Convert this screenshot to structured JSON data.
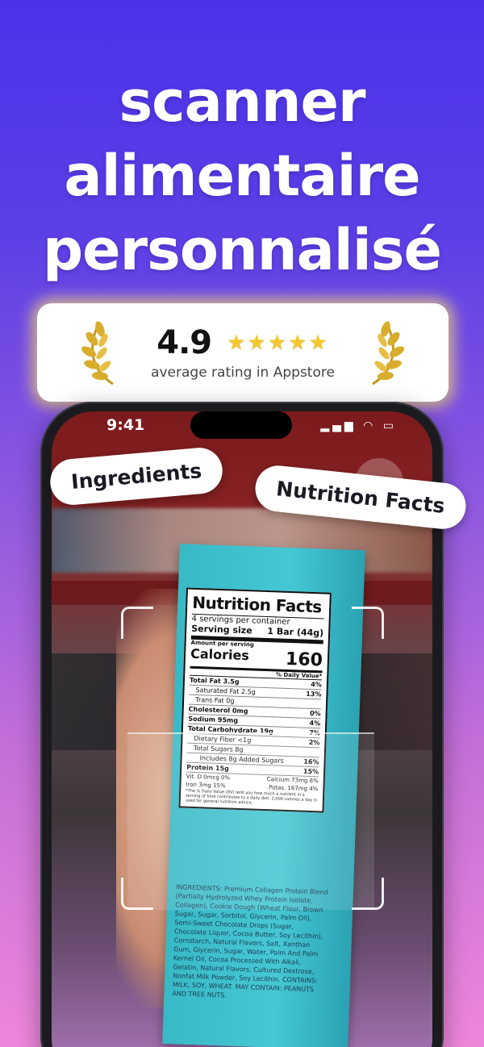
{
  "headline": {
    "line1": "scanner",
    "line2": "alimentaire",
    "line3": "personnalisé"
  },
  "rating": {
    "value": "4.9",
    "stars": "★★★★★",
    "caption": "average rating in Appstore"
  },
  "status_bar": {
    "time": "9:41",
    "icons": "▂▄▆ ◠ ▭"
  },
  "tags": {
    "ingredients": "Ingredients",
    "nutrition_facts": "Nutrition Facts"
  },
  "nutrition_label": {
    "title": "Nutrition Facts",
    "servings": "4 servings per container",
    "serving_size_label": "Serving size",
    "serving_size_value": "1 Bar (44g)",
    "amount_per_serving": "Amount per serving",
    "calories_label": "Calories",
    "calories_value": "160",
    "daily_value_header": "% Daily Value*",
    "rows": [
      {
        "label": "Total Fat 3.5g",
        "pct": "4%",
        "style": "bold"
      },
      {
        "label": "Saturated Fat 2.5g",
        "pct": "13%",
        "style": "indent"
      },
      {
        "label": "Trans Fat 0g",
        "pct": "",
        "style": "indent"
      },
      {
        "label": "Cholesterol 0mg",
        "pct": "0%",
        "style": "bold"
      },
      {
        "label": "Sodium 95mg",
        "pct": "4%",
        "style": "bold"
      },
      {
        "label": "Total Carbohydrate 19g",
        "pct": "7%",
        "style": "bold"
      },
      {
        "label": "Dietary Fiber <1g",
        "pct": "2%",
        "style": "indent"
      },
      {
        "label": "Total Sugars 8g",
        "pct": "",
        "style": "indent"
      },
      {
        "label": "Includes 8g Added Sugars",
        "pct": "16%",
        "style": "indent2"
      },
      {
        "label": "Protein 15g",
        "pct": "15%",
        "style": "bold"
      }
    ],
    "vitamins": [
      {
        "left": "Vit. D 0mcg 0%",
        "right": "Calcium 73mg 6%"
      },
      {
        "left": "Iron 3mg 15%",
        "right": "Potas. 167mg 4%"
      }
    ],
    "footnote": "*The % Daily Value (DV) tells you how much a nutrient in a serving of food contributes to a daily diet. 2,000 calories a day is used for general nutrition advice."
  },
  "ingredients_text": "INGREDIENTS: Premium Collagen Protein Blend (Partially Hydrolyzed Whey Protein Isolate, Collagen), Cookie Dough (Wheat Flour, Brown Sugar, Sugar, Sorbitol, Glycerin, Palm Oil), Semi-Sweet Chocolate Drops (Sugar, Chocolate Liquor, Cocoa Butter, Soy Lecithin), Cornstarch, Natural Flavors, Salt, Xanthan Gum, Glycerin, Sugar, Water, Palm And Palm Kernel Oil, Cocoa Processed With Alkali, Gelatin, Natural Flavors, Cultured Dextrose, Nonfat Milk Powder, Soy Lecithin. CONTAINS: MILK, SOY, WHEAT. MAY CONTAIN: PEANUTS AND TREE NUTS."
}
